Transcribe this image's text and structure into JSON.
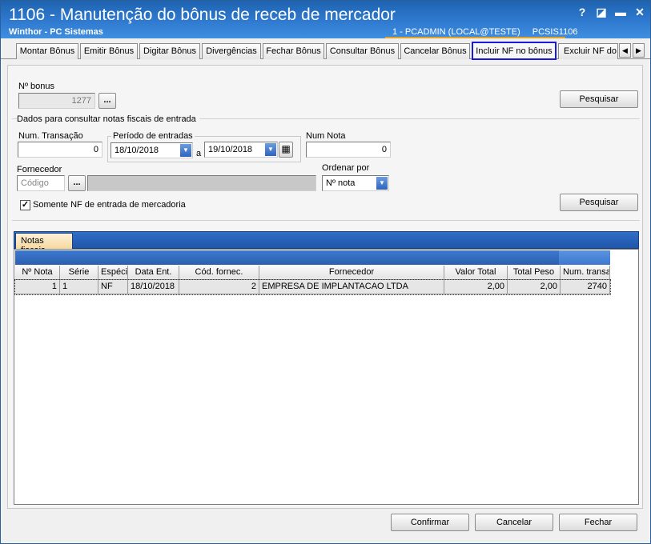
{
  "window": {
    "title": "1106 - Manutenção do bônus de receb de mercador",
    "subtitle": "Winthor - PC Sistemas",
    "user_info": "1 - PCADMIN (LOCAL@TESTE)",
    "program_code": "PCSIS1106",
    "controls": {
      "help": "?",
      "restore": "◪",
      "minimize": "▬",
      "close": "✕"
    }
  },
  "tabs": [
    {
      "label": "Montar Bônus"
    },
    {
      "label": "Emitir Bônus"
    },
    {
      "label": "Digitar Bônus"
    },
    {
      "label": "Divergências"
    },
    {
      "label": "Fechar Bônus"
    },
    {
      "label": "Consultar Bônus"
    },
    {
      "label": "Cancelar Bônus"
    },
    {
      "label": "Incluir NF no bônus",
      "active": true
    },
    {
      "label": "Excluir NF do bônus"
    }
  ],
  "tab_scroll": {
    "left": "◀",
    "right": "▶"
  },
  "form": {
    "bonus_label": "Nº bonus",
    "bonus_value": "1277",
    "ellipsis": "...",
    "search_button_1": "Pesquisar",
    "section_title": "Dados para consultar notas fiscais de entrada",
    "transaction_label": "Num. Transação",
    "transaction_value": "0",
    "period_label": "Período de entradas",
    "date_from": "18/10/2018",
    "date_sep": "a",
    "date_to": "19/10/2018",
    "nota_label": "Num Nota",
    "nota_value": "0",
    "supplier_label": "Fornecedor",
    "supplier_code_placeholder": "Código",
    "order_label": "Ordenar por",
    "order_value": "Nº nota",
    "checkbox_label": "Somente NF de entrada de mercadoria",
    "checkbox_checked": true,
    "search_button_2": "Pesquisar"
  },
  "nf": {
    "tab_label": "Notas fiscais",
    "columns": [
      "Nº Nota",
      "Série",
      "Espéci",
      "Data Ent.",
      "Cód. fornec.",
      "Fornecedor",
      "Valor Total",
      "Total Peso",
      "Num. transa"
    ],
    "rows": [
      [
        "1",
        "1",
        "NF",
        "18/10/2018",
        "2",
        "EMPRESA DE IMPLANTACAO LTDA",
        "2,00",
        "2,00",
        "2740"
      ]
    ]
  },
  "footer": {
    "confirm": "Confirmar",
    "cancel": "Cancelar",
    "close": "Fechar"
  },
  "colors": {
    "titlebar": "#2f7ad0",
    "active_tab_border": "#1a1ad8",
    "grid_header": "#2b5fb0",
    "nf_tab": "#f6d8a0"
  }
}
